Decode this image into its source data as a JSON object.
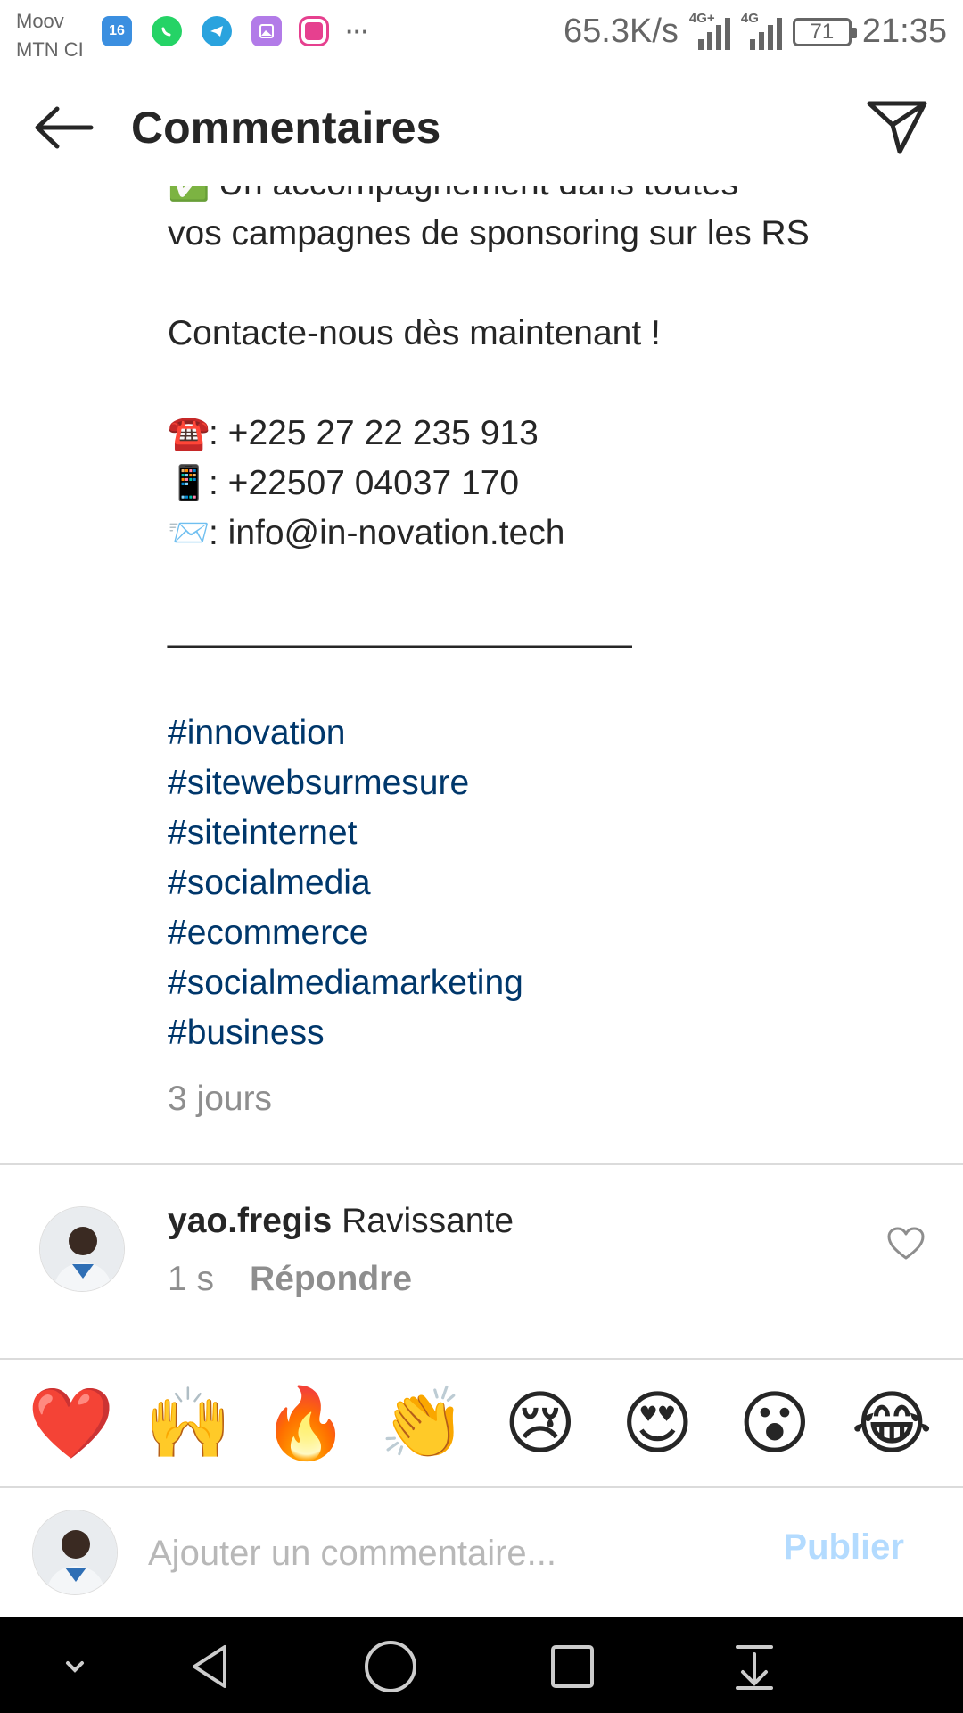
{
  "status_bar": {
    "carrier_1": "Moov",
    "carrier_2": "MTN CI",
    "calendar_badge": "16",
    "more_icons": "···",
    "net_speed": "65.3K/s",
    "signal_1_tag": "4G+",
    "signal_2_tag": "4G",
    "battery": "71",
    "time": "21:35"
  },
  "header": {
    "title": "Commentaires"
  },
  "caption": {
    "line_top": "Un accompagnement dans toutes",
    "line_campaign": "vos campagnes de sponsoring sur les RS",
    "contact_cta": "Contacte-nous dès maintenant !",
    "phone_emoji": "☎️",
    "phone": ": +225 27 22 235 913",
    "mobile_emoji": "📱",
    "mobile": ": +22507 04037 170",
    "mail_emoji": "📨",
    "email": ": info@in-novation.tech",
    "separator": "________________________",
    "hashtags": [
      "#innovation",
      "#sitewebsurmesure",
      "#siteinternet",
      "#socialmedia",
      "#ecommerce",
      "#socialmediamarketing",
      "#business"
    ],
    "time": "3 jours"
  },
  "comment": {
    "username": "yao.fregis",
    "text": "Ravissante",
    "time": "1 s",
    "reply_label": "Répondre"
  },
  "reactions": [
    "❤️",
    "🙌",
    "🔥",
    "👏",
    "😢",
    "😍",
    "😮",
    "😂"
  ],
  "composer": {
    "placeholder": "Ajouter un commentaire...",
    "publish_label": "Publier"
  },
  "colors": {
    "hashtag": "#00376b",
    "publish_disabled": "#b3dbff",
    "secondary_text": "#8e8e8e"
  }
}
